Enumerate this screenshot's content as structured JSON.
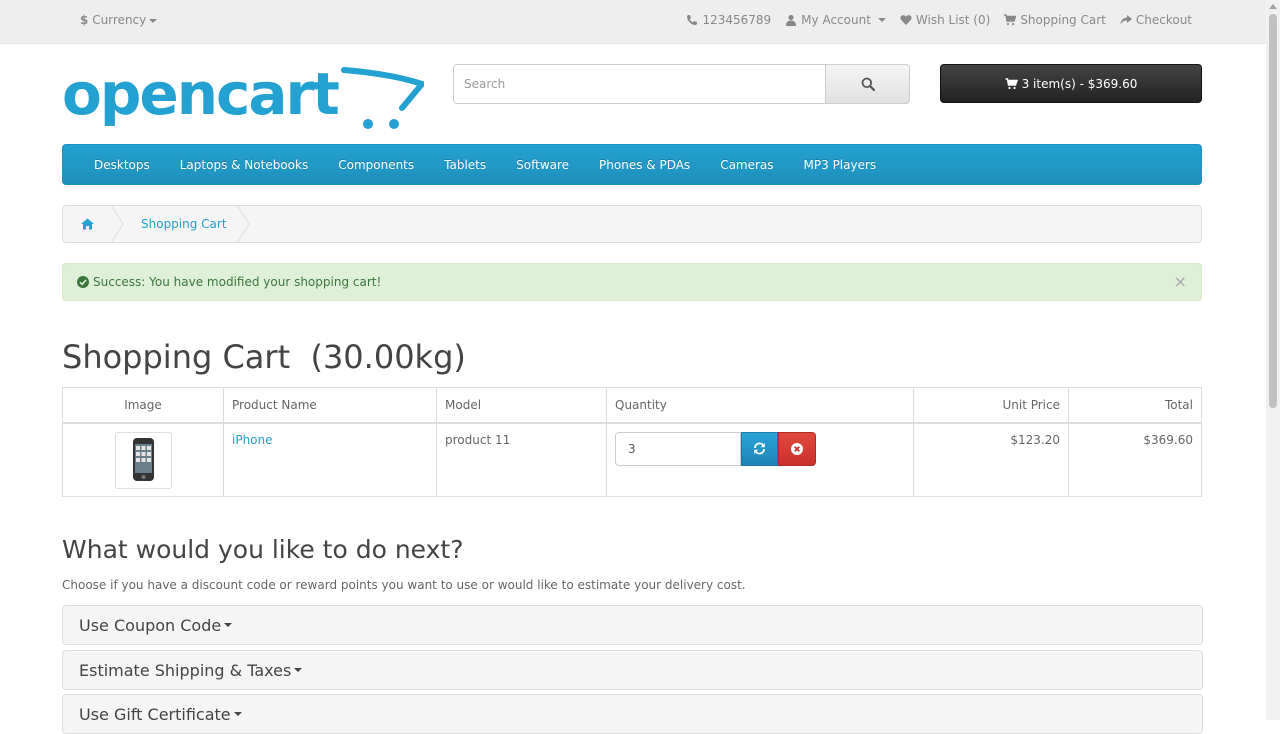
{
  "topbar": {
    "currency_label": "Currency",
    "phone": "123456789",
    "my_account": "My Account",
    "wishlist": "Wish List (0)",
    "shopping_cart": "Shopping Cart",
    "checkout": "Checkout"
  },
  "header": {
    "logo_text": "opencart",
    "search_placeholder": "Search",
    "cart_button": "3 item(s) - $369.60"
  },
  "menu": [
    "Desktops",
    "Laptops & Notebooks",
    "Components",
    "Tablets",
    "Software",
    "Phones & PDAs",
    "Cameras",
    "MP3 Players"
  ],
  "breadcrumb": {
    "current": "Shopping Cart"
  },
  "alert": {
    "message": "Success: You have modified your shopping cart!",
    "close": "×"
  },
  "cart": {
    "title": "Shopping Cart  (30.00kg)",
    "columns": [
      "Image",
      "Product Name",
      "Model",
      "Quantity",
      "Unit Price",
      "Total"
    ],
    "rows": [
      {
        "product": "iPhone",
        "model": "product 11",
        "quantity": "3",
        "unit_price": "$123.20",
        "total": "$369.60"
      }
    ]
  },
  "next": {
    "heading": "What would you like to do next?",
    "description": "Choose if you have a discount code or reward points you want to use or would like to estimate your delivery cost.",
    "panels": [
      "Use Coupon Code",
      "Estimate Shipping & Taxes",
      "Use Gift Certificate"
    ]
  },
  "colors": {
    "accent": "#23a1d1",
    "danger": "#c9302c",
    "success_bg": "#dff0d8",
    "success_text": "#3c763d"
  }
}
